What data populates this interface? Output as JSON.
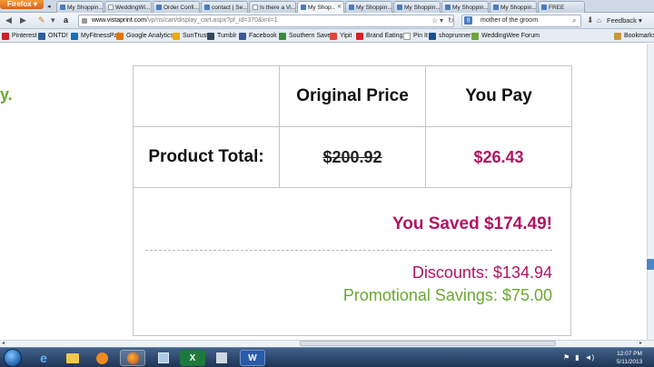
{
  "browser": {
    "menu_button": "Firefox",
    "tabs": [
      {
        "label": "My Shoppin...",
        "active": false
      },
      {
        "label": "WeddingWi...",
        "active": false
      },
      {
        "label": "Order Confi...",
        "active": false
      },
      {
        "label": "contact | Se...",
        "active": false
      },
      {
        "label": "Is there a Vi...",
        "active": false
      },
      {
        "label": "My Shop...",
        "active": true
      },
      {
        "label": "My Shoppin...",
        "active": false
      },
      {
        "label": "My Shoppin...",
        "active": false
      },
      {
        "label": "My Shoppin...",
        "active": false
      },
      {
        "label": "My Shoppin...",
        "active": false
      },
      {
        "label": "FREE",
        "active": false
      }
    ],
    "url_host": "www.vistaprint.com",
    "url_path": "/vp/ns/cart/display_cart.aspx?pf_id=370&xnl=1",
    "search_value": "mother of the groom",
    "feedback_label": "Feedback",
    "bookmarks": [
      {
        "label": "Pinterest",
        "color": "#cb2027"
      },
      {
        "label": "ONTD!",
        "color": "#2d5f9a"
      },
      {
        "label": "MyFitnessPal",
        "color": "#1a6fb7"
      },
      {
        "label": "Google Analytics",
        "color": "#e37400"
      },
      {
        "label": "SunTrust",
        "color": "#f2a900"
      },
      {
        "label": "Tumblr",
        "color": "#36465d"
      },
      {
        "label": "Facebook",
        "color": "#3b5998"
      },
      {
        "label": "Southern Savers",
        "color": "#3a8b3a"
      },
      {
        "label": "Yipit",
        "color": "#e0463a"
      },
      {
        "label": "Brand Eating",
        "color": "#d8202a"
      },
      {
        "label": "Pin It",
        "color": "#ffffff"
      },
      {
        "label": "shoprunner",
        "color": "#1d4f91"
      },
      {
        "label": "WeddingWee Forum",
        "color": "#6fa43a"
      }
    ],
    "bookmarks_menu": "Bookmarks"
  },
  "page": {
    "left_fragment": "y.",
    "table": {
      "col_original": "Original Price",
      "col_you_pay": "You Pay",
      "row_label": "Product Total:",
      "original_price": "$200.92",
      "you_pay": "$26.43"
    },
    "you_saved": "You Saved $174.49!",
    "discounts": "Discounts: $134.94",
    "promotional": "Promotional Savings: $75.00"
  },
  "taskbar": {
    "clock_time": "12:07 PM",
    "clock_date": "5/11/2013"
  },
  "colors": {
    "accent_magenta": "#b01561",
    "accent_green": "#6aa833"
  }
}
